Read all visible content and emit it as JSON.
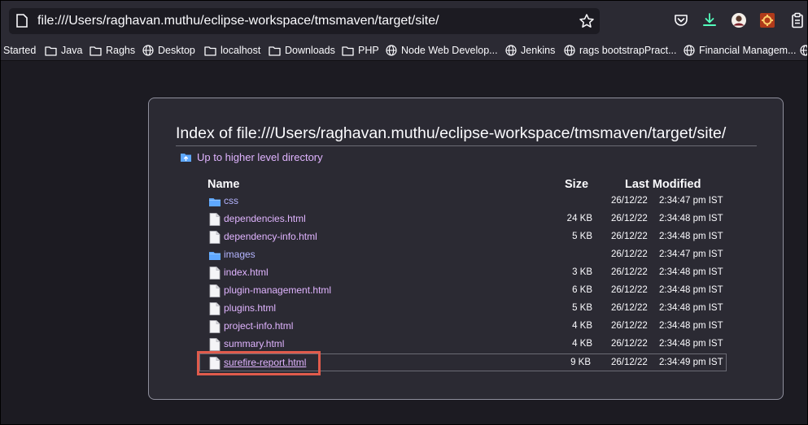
{
  "urlbar": {
    "url": "file:///Users/raghavan.muthu/eclipse-workspace/tmsmaven/target/site/"
  },
  "toolbar_icons": [
    "pocket-icon",
    "downloads-icon",
    "account-avatar",
    "extension-icon",
    "clipboard-icon"
  ],
  "bookmarks": [
    {
      "label": "Started",
      "icon": "none"
    },
    {
      "label": "Java",
      "icon": "folder"
    },
    {
      "label": "Raghs",
      "icon": "folder"
    },
    {
      "label": "Desktop",
      "icon": "globe"
    },
    {
      "label": "localhost",
      "icon": "folder"
    },
    {
      "label": "Downloads",
      "icon": "folder"
    },
    {
      "label": "PHP",
      "icon": "folder"
    },
    {
      "label": "Node Web Develop...",
      "icon": "globe"
    },
    {
      "label": "Jenkins",
      "icon": "globe"
    },
    {
      "label": "rags bootstrapPract...",
      "icon": "globe"
    },
    {
      "label": "Financial Managem...",
      "icon": "globe"
    }
  ],
  "listing": {
    "title": "Index of file:///Users/raghavan.muthu/eclipse-workspace/tmsmaven/target/site/",
    "up_dir": "Up to higher level directory",
    "columns": {
      "name": "Name",
      "size": "Size",
      "modified": "Last Modified"
    },
    "rows": [
      {
        "name": "css",
        "type": "dir",
        "size": "",
        "date": "26/12/22",
        "time": "2:34:47 pm IST"
      },
      {
        "name": "dependencies.html",
        "type": "file",
        "size": "24 KB",
        "date": "26/12/22",
        "time": "2:34:48 pm IST"
      },
      {
        "name": "dependency-info.html",
        "type": "file",
        "size": "5 KB",
        "date": "26/12/22",
        "time": "2:34:48 pm IST"
      },
      {
        "name": "images",
        "type": "dir",
        "size": "",
        "date": "26/12/22",
        "time": "2:34:47 pm IST"
      },
      {
        "name": "index.html",
        "type": "file",
        "size": "3 KB",
        "date": "26/12/22",
        "time": "2:34:48 pm IST"
      },
      {
        "name": "plugin-management.html",
        "type": "file",
        "size": "6 KB",
        "date": "26/12/22",
        "time": "2:34:48 pm IST"
      },
      {
        "name": "plugins.html",
        "type": "file",
        "size": "5 KB",
        "date": "26/12/22",
        "time": "2:34:48 pm IST"
      },
      {
        "name": "project-info.html",
        "type": "file",
        "size": "4 KB",
        "date": "26/12/22",
        "time": "2:34:48 pm IST"
      },
      {
        "name": "summary.html",
        "type": "file",
        "size": "4 KB",
        "date": "26/12/22",
        "time": "2:34:48 pm IST"
      },
      {
        "name": "surefire-report.html",
        "type": "file",
        "size": "9 KB",
        "date": "26/12/22",
        "time": "2:34:49 pm IST",
        "selected": true
      }
    ]
  },
  "colors": {
    "link": "#e0b4ff",
    "folder": "#5fa8ff",
    "highlight": "#e05b4c"
  }
}
